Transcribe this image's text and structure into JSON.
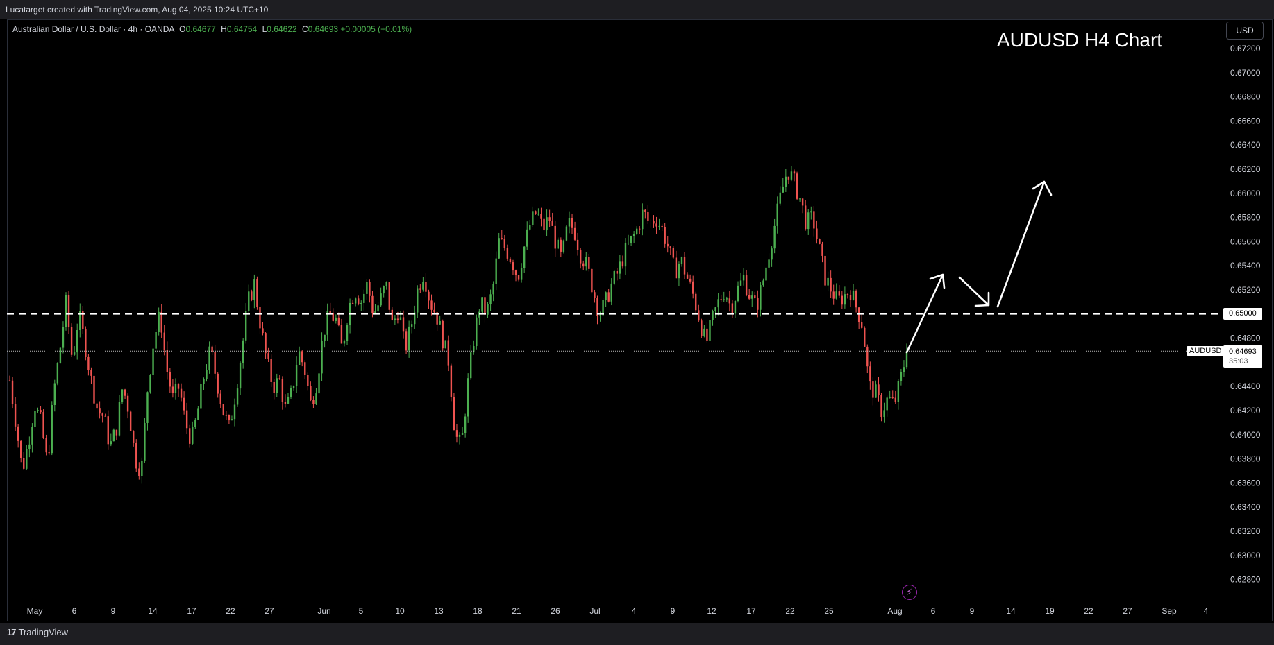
{
  "header": {
    "attribution": "Lucatarget created with TradingView.com, Aug 04, 2025 10:24 UTC+10"
  },
  "legend": {
    "symbol": "Australian Dollar / U.S. Dollar · 4h · OANDA",
    "o_label": "O",
    "o_value": "0.64677",
    "h_label": "H",
    "h_value": "0.64754",
    "l_label": "L",
    "l_value": "0.64622",
    "c_label": "C",
    "c_value": "0.64693",
    "change": "+0.00005 (+0.01%)"
  },
  "chart_title": "AUDUSD H4 Chart",
  "currency_button": "USD",
  "price_scale_labels": [
    "0.67200",
    "0.67000",
    "0.66800",
    "0.66600",
    "0.66400",
    "0.66200",
    "0.66000",
    "0.65800",
    "0.65600",
    "0.65400",
    "0.65200",
    "0.65000",
    "0.64800",
    "0.64600",
    "0.64400",
    "0.64200",
    "0.64000",
    "0.63800",
    "0.63600",
    "0.63400",
    "0.63200",
    "0.63000",
    "0.62800"
  ],
  "time_axis_labels": [
    "May",
    "6",
    "9",
    "14",
    "17",
    "22",
    "27",
    "Jun",
    "5",
    "10",
    "13",
    "18",
    "21",
    "26",
    "Jul",
    "4",
    "9",
    "12",
    "17",
    "22",
    "25",
    "Aug",
    "6",
    "9",
    "14",
    "19",
    "22",
    "27",
    "Sep",
    "4"
  ],
  "level_line": {
    "value": "0.65000"
  },
  "current_price": {
    "symbol": "AUDUSD",
    "value": "0.64693",
    "countdown": "35:03"
  },
  "brand": {
    "name": "TradingView"
  },
  "colors": {
    "up": "#4caf50",
    "down": "#ef5350",
    "background": "#000000",
    "annotation": "#ffffff"
  },
  "chart_data": {
    "type": "candlestick",
    "title": "AUDUSD H4 Chart",
    "ylim": [
      0.627,
      0.673
    ],
    "key_level": 0.65,
    "last_close": 0.64693,
    "price_path": [
      [
        0.6445,
        0.641,
        0.637,
        0.6395,
        0.6425,
        0.641,
        0.6375,
        0.6435,
        0.647,
        0.651,
        0.646,
        0.65,
        0.6475,
        0.6445,
        0.642,
        0.6415,
        0.639,
        0.6405,
        0.644,
        0.642
      ],
      [
        0.638,
        0.637,
        0.644,
        0.648,
        0.65,
        0.6455,
        0.643,
        0.644,
        0.641,
        0.6395,
        0.642,
        0.645,
        0.647,
        0.6445,
        0.642,
        0.6405,
        0.6435,
        0.647,
        0.651,
        0.6525
      ],
      [
        0.649,
        0.646,
        0.644,
        0.6445,
        0.642,
        0.6435,
        0.647,
        0.6455,
        0.6425,
        0.6445,
        0.6485,
        0.65,
        0.6495,
        0.647,
        0.6505,
        0.652,
        0.651,
        0.6525,
        0.65,
        0.651
      ],
      [
        0.6525,
        0.649,
        0.6505,
        0.647,
        0.649,
        0.652,
        0.6535,
        0.651,
        0.65,
        0.648,
        0.646,
        0.64,
        0.639,
        0.644,
        0.648,
        0.651,
        0.65,
        0.652,
        0.656,
        0.6555
      ],
      [
        0.6545,
        0.653,
        0.6555,
        0.6575,
        0.6585,
        0.657,
        0.658,
        0.656,
        0.6545,
        0.6575,
        0.657,
        0.655,
        0.654,
        0.652,
        0.65,
        0.651,
        0.6525,
        0.6535,
        0.655,
        0.656
      ],
      [
        0.657,
        0.6585,
        0.6575,
        0.658,
        0.657,
        0.6555,
        0.6535,
        0.6545,
        0.653,
        0.6515,
        0.6495,
        0.6475,
        0.6495,
        0.651,
        0.652,
        0.6505,
        0.652,
        0.653,
        0.6515,
        0.6505
      ],
      [
        0.6525,
        0.655,
        0.6575,
        0.66,
        0.662,
        0.661,
        0.6595,
        0.6575,
        0.658,
        0.6555,
        0.653,
        0.652,
        0.651,
        0.6515,
        0.652,
        0.6505,
        0.649,
        0.644,
        0.6435,
        0.642
      ],
      [
        0.643,
        0.6425,
        0.6445,
        0.6469
      ]
    ]
  }
}
